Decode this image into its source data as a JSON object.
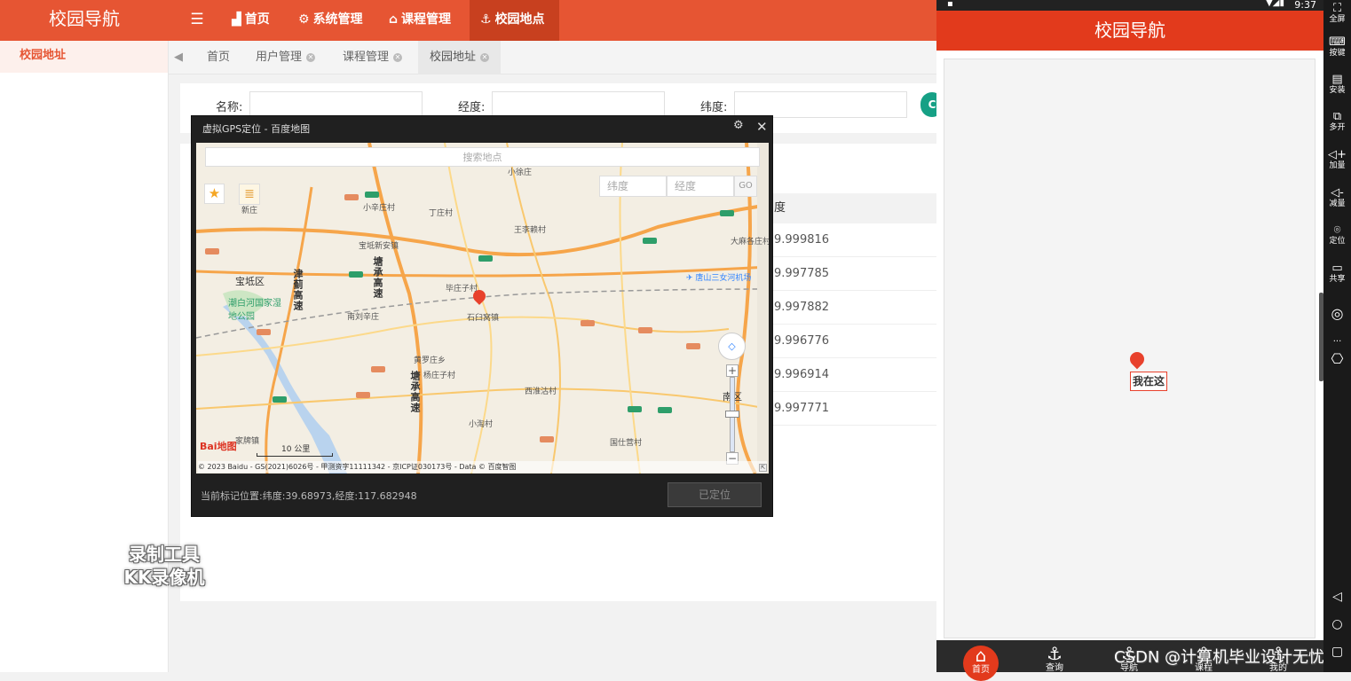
{
  "admin": {
    "logo": "校园导航",
    "menu_icon": "menu-icon",
    "nav": [
      {
        "label": "首页",
        "icon": "chart-icon"
      },
      {
        "label": "系统管理",
        "icon": "gear-icon"
      },
      {
        "label": "课程管理",
        "icon": "bank-icon"
      },
      {
        "label": "校园地点",
        "icon": "anchor-icon",
        "active": true
      }
    ],
    "sidebar": [
      {
        "label": "校园地址"
      }
    ],
    "tabs": [
      {
        "label": "首页"
      },
      {
        "label": "用户管理"
      },
      {
        "label": "课程管理"
      },
      {
        "label": "校园地址"
      }
    ],
    "filter": {
      "name_label": "名称:",
      "lng_label": "经度:",
      "lat_label": "纬度:",
      "search_button": "C"
    },
    "table": {
      "lat_header": "度",
      "lat_values": [
        "9.999816",
        "9.997785",
        "9.997882",
        "9.996776",
        "9.996914",
        "9.997771"
      ]
    },
    "watermark": [
      "录制工具",
      "KK录像机"
    ]
  },
  "gps_dialog": {
    "title": "虚拟GPS定位 - 百度地图",
    "search_placeholder": "搜索地点",
    "lat_placeholder": "纬度",
    "lng_placeholder": "经度",
    "go_label": "GO",
    "status": "当前标记位置:纬度:39.68973,经度:117.682948",
    "button": "已定位",
    "map": {
      "labels": {
        "baodi_district": "宝坻区",
        "nanqu": "南区",
        "shijiuwozhen": "石臼窝镇",
        "xiaoxinzhuang": "小辛庄村",
        "dingzhuang": "丁庄村",
        "wangzhihu": "王李赖村",
        "baodi_xinan": "宝坻新安镇",
        "huazhuangzi": "毕庄子村",
        "nanliuxin": "南刘辛庄",
        "huangluozhuang": "黄罗庄乡",
        "yangzhuangzi": "杨庄子村",
        "xihuaigu": "西淮沽村",
        "xiaohuai": "小淘村",
        "guozhuang": "国仕营村",
        "xiaoxuzhuang": "小徐庄",
        "dazhuang": "大麻各庄村",
        "jiazhuang": "家牌镇",
        "xinzhuang": "新庄",
        "hw_tangchengaosu": "塘承高速",
        "hw_tangchengaosu_2": "塘承高速",
        "hw_jinjigaosu": "津蓟高速",
        "airport": "唐山三女河机场",
        "wetland": "潮白河国家湿地公园",
        "scale": "10 公里",
        "baidu": "Bai地图",
        "copyright": "© 2023 Baidu - GS(2021)6026号 - 甲测资字11111342 - 京ICP证030173号 - Data © 百度智图"
      }
    }
  },
  "phone": {
    "status_time": "9:37",
    "header": "校园导航",
    "marker_label": "我在这",
    "tabs": [
      {
        "label": "首页",
        "icon": "home-icon"
      },
      {
        "label": "查询",
        "icon": "anchor-icon"
      },
      {
        "label": "导航",
        "icon": "anchor-icon"
      },
      {
        "label": "课程",
        "icon": "anchor-icon"
      },
      {
        "label": "我的",
        "icon": "anchor-icon"
      }
    ],
    "csdn_watermark": "CSDN @计算机毕业设计无忧"
  },
  "emulator": {
    "items": [
      {
        "label": "全屏",
        "icon": "fullscreen-icon"
      },
      {
        "label": "按键",
        "icon": "keyboard-icon"
      },
      {
        "label": "安装",
        "icon": "apk-icon"
      },
      {
        "label": "多开",
        "icon": "multi-icon"
      },
      {
        "label": "加量",
        "icon": "volume-up-icon"
      },
      {
        "label": "减量",
        "icon": "volume-down-icon"
      },
      {
        "label": "定位",
        "icon": "location-icon"
      },
      {
        "label": "共享",
        "icon": "folder-icon"
      }
    ]
  }
}
